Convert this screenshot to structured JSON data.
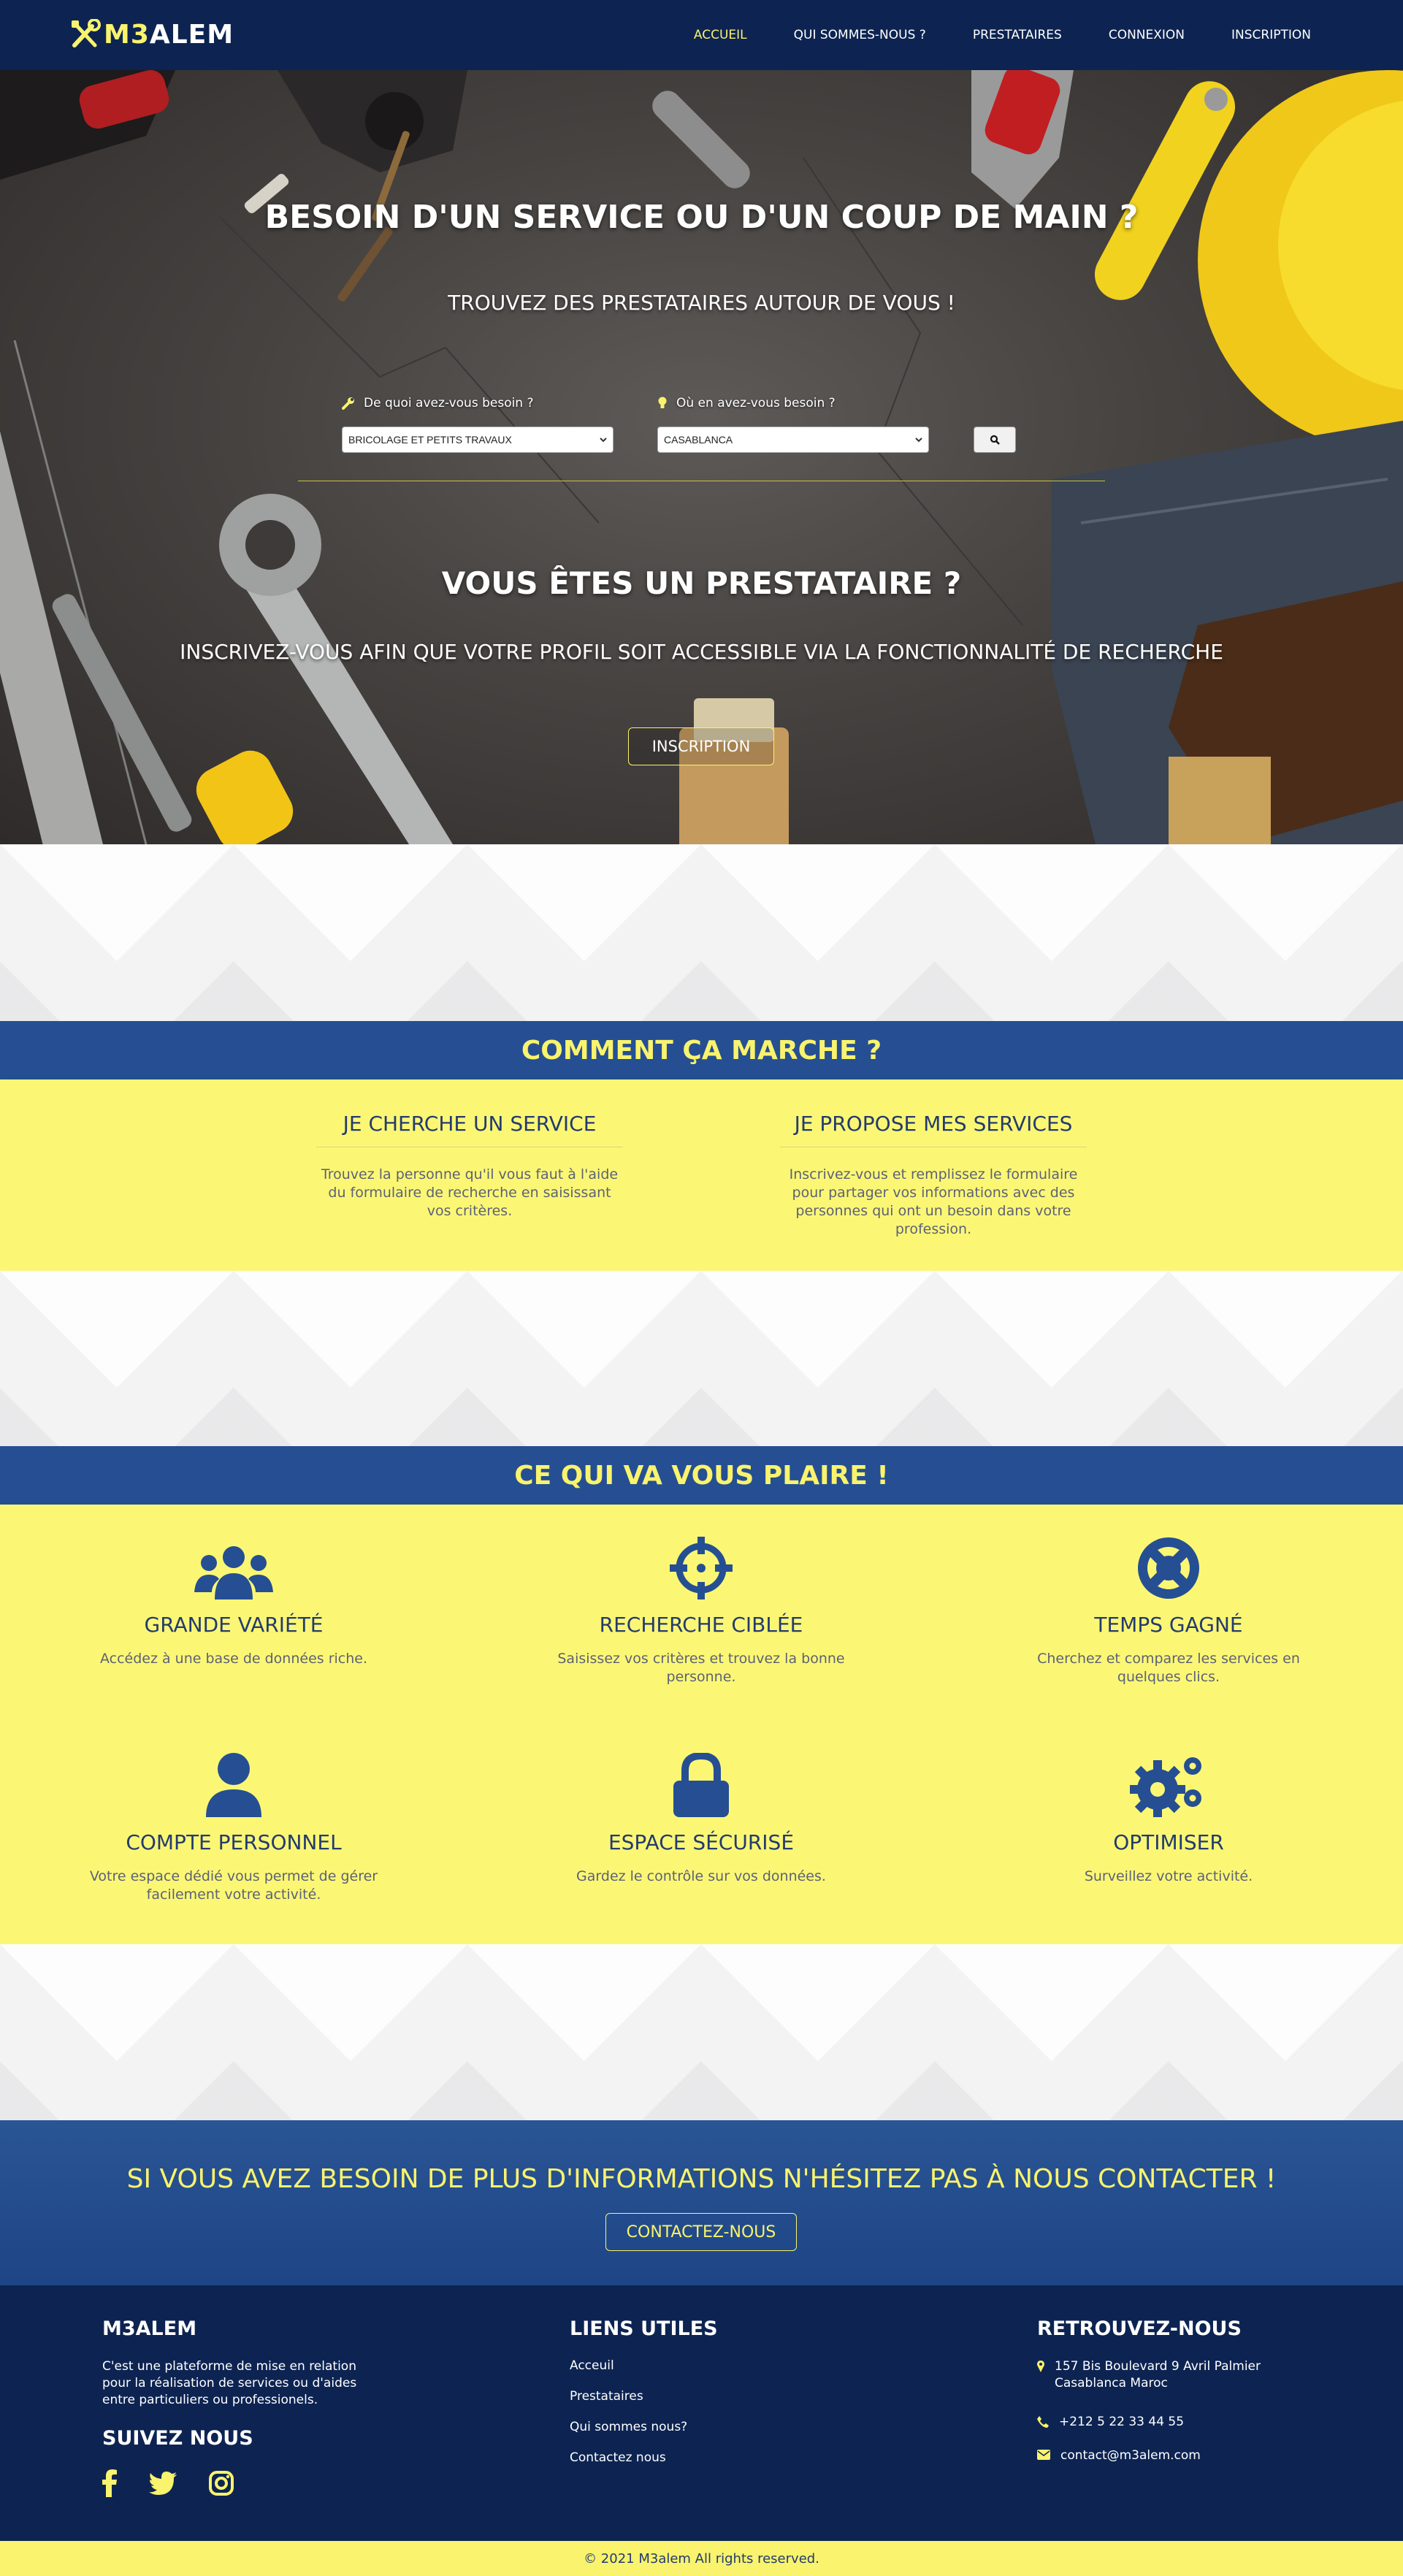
{
  "nav": {
    "logo_prefix": "M3",
    "logo_suffix": "ALEM",
    "items": [
      {
        "label": "ACCUEIL",
        "active": true
      },
      {
        "label": "QUI SOMMES-NOUS ?"
      },
      {
        "label": "PRESTATAIRES"
      },
      {
        "label": "CONNEXION"
      },
      {
        "label": "INSCRIPTION"
      }
    ]
  },
  "hero": {
    "title": "BESOIN D'UN SERVICE OU D'UN COUP DE MAIN ?",
    "subtitle": "TROUVEZ DES PRESTATAIRES AUTOUR DE VOUS !",
    "search": {
      "service_label": "De quoi avez-vous besoin ?",
      "service_value": "BRICOLAGE ET PETITS TRAVAUX",
      "location_label": "Où en avez-vous besoin ?",
      "location_value": "CASABLANCA",
      "button_icon": "search-icon"
    },
    "provider_title": "VOUS ÊTES UN PRESTATAIRE ?",
    "provider_subtitle": "INSCRIVEZ-VOUS AFIN QUE VOTRE PROFIL SOIT ACCESSIBLE VIA LA FONCTIONNALITÉ DE RECHERCHE",
    "provider_button": "INSCRIPTION"
  },
  "how": {
    "title": "COMMENT ÇA MARCHE ?",
    "columns": [
      {
        "title": "JE CHERCHE UN SERVICE",
        "text": "Trouvez la personne qu'il vous faut à l'aide du formulaire de recherche en saisissant vos critères."
      },
      {
        "title": "JE PROPOSE MES SERVICES",
        "text": "Inscrivez-vous et remplissez le formulaire pour partager vos informations avec des personnes qui ont un besoin dans votre profession."
      }
    ]
  },
  "features": {
    "title": "CE QUI VA VOUS PLAIRE !",
    "items": [
      {
        "icon": "users-icon",
        "title": "GRANDE VARIÉTÉ",
        "text": "Accédez à une base de données riche."
      },
      {
        "icon": "crosshairs-icon",
        "title": "RECHERCHE CIBLÉE",
        "text": "Saisissez vos critères et trouvez la bonne personne."
      },
      {
        "icon": "life-ring-icon",
        "title": "TEMPS GAGNÉ",
        "text": "Cherchez et comparez les services en quelques clics."
      },
      {
        "icon": "user-icon",
        "title": "COMPTE PERSONNEL",
        "text": "Votre espace dédié vous permet de gérer facilement votre activité."
      },
      {
        "icon": "lock-icon",
        "title": "ESPACE SÉCURISÉ",
        "text": "Gardez le contrôle sur vos données."
      },
      {
        "icon": "cogs-icon",
        "title": "OPTIMISER",
        "text": "Surveillez votre activité."
      }
    ]
  },
  "contact": {
    "title": "SI VOUS AVEZ BESOIN DE PLUS D'INFORMATIONS N'HÉSITEZ PAS À NOUS CONTACTER !",
    "button": "CONTACTEZ-NOUS"
  },
  "footer": {
    "about_title": "M3ALEM",
    "about_text": "C'est une plateforme de mise en relation pour la réalisation de services ou d'aides entre particuliers ou professionels.",
    "follow_title": "SUIVEZ NOUS",
    "social": [
      "facebook-icon",
      "twitter-icon",
      "instagram-icon"
    ],
    "links_title": "LIENS UTILES",
    "links": [
      "Acceuil",
      "Prestataires",
      "Qui sommes nous?",
      "Contactez nous"
    ],
    "find_title": "RETROUVEZ-NOUS",
    "address": "157 Bis Boulevard 9 Avril Palmier Casablanca Maroc",
    "phone": "+212 5 22 33 44 55",
    "email": "contact@m3alem.com",
    "copyright": "© 2021 M3alem All rights reserved."
  },
  "colors": {
    "navy": "#0d2452",
    "blue": "#254f92",
    "yellow": "#f9f36d",
    "band_yellow": "#fbf775"
  }
}
